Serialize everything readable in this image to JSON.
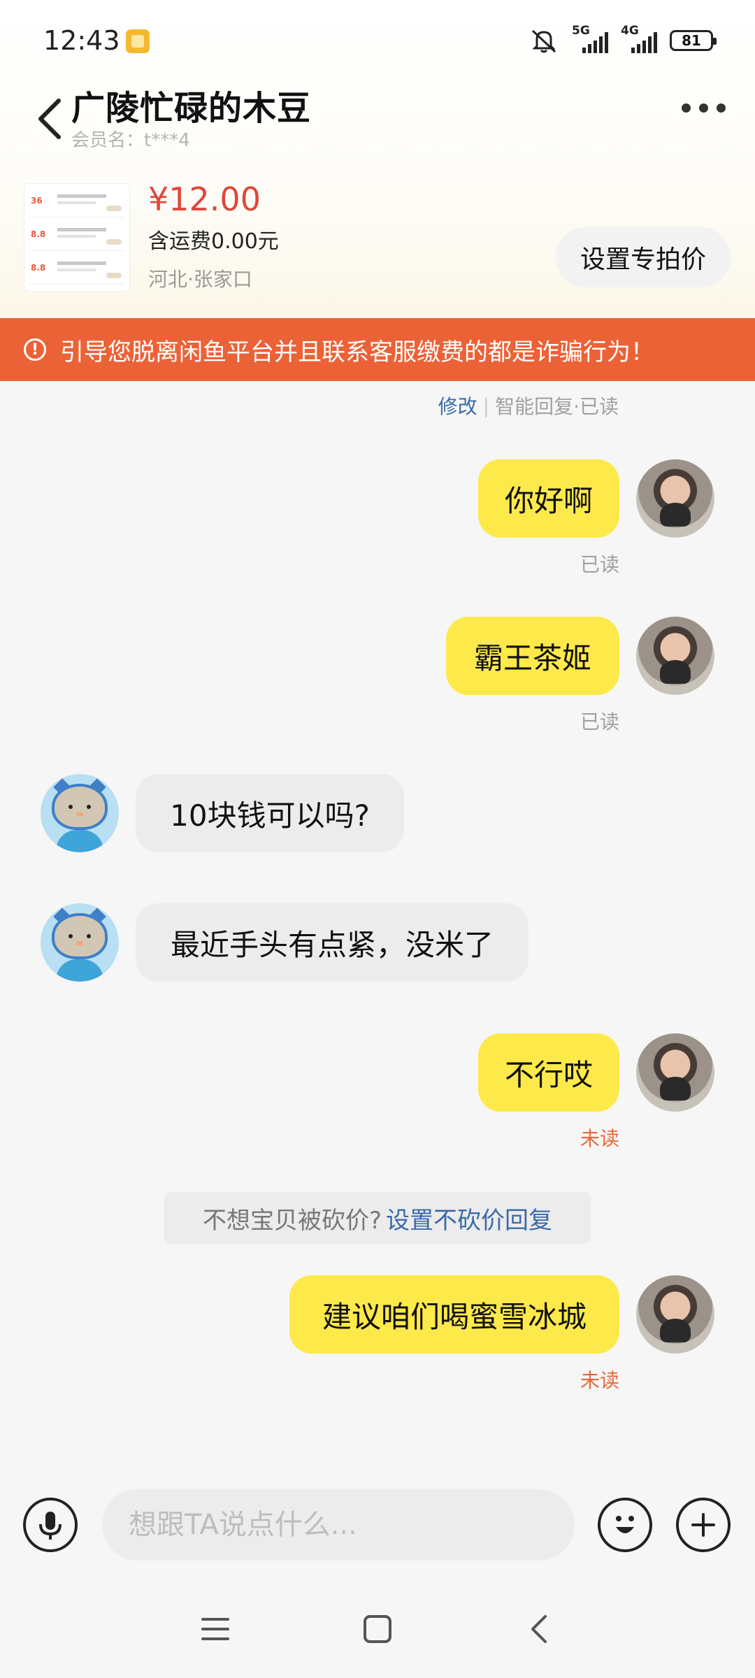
{
  "status_bar": {
    "time": "12:43",
    "signal_1": "5G",
    "signal_2": "4G",
    "battery": "81"
  },
  "header": {
    "title": "广陵忙碌的木豆",
    "subtitle": "会员名：t***4"
  },
  "product": {
    "price": "¥12.00",
    "shipping": "含运费0.00元",
    "location": "河北·张家口",
    "set_price_label": "设置专拍价",
    "thumb_prices": [
      "36",
      "8.8",
      "8.8"
    ]
  },
  "warning": {
    "text": "引导您脱离闲鱼平台并且联系客服缴费的都是诈骗行为！"
  },
  "status_line": {
    "edit": "修改",
    "separator": "|",
    "status": "智能回复·已读"
  },
  "messages": [
    {
      "side": "me",
      "text": "你好啊",
      "receipt": "已读"
    },
    {
      "side": "me",
      "text": "霸王茶姬",
      "receipt": "已读"
    },
    {
      "side": "them",
      "text": "10块钱可以吗?"
    },
    {
      "side": "them",
      "text": "最近手头有点紧，没米了"
    },
    {
      "side": "me",
      "text": "不行哎",
      "receipt": "未读"
    },
    {
      "side": "me",
      "text": "建议咱们喝蜜雪冰城",
      "receipt": "未读"
    }
  ],
  "hint": {
    "text": "不想宝贝被砍价?",
    "link": "设置不砍价回复"
  },
  "input": {
    "placeholder": "想跟TA说点什么..."
  },
  "colors": {
    "warning_bg": "#ec6237",
    "my_bubble": "#fde94a",
    "their_bubble": "#ececec",
    "price": "#e0473a",
    "link": "#3a6aa8",
    "unread": "#e8673b"
  },
  "icons": [
    "back-arrow-icon",
    "more-dots-icon",
    "warning-icon",
    "microphone-icon",
    "emoji-icon",
    "plus-icon",
    "menu-icon",
    "home-square-icon",
    "back-icon"
  ]
}
